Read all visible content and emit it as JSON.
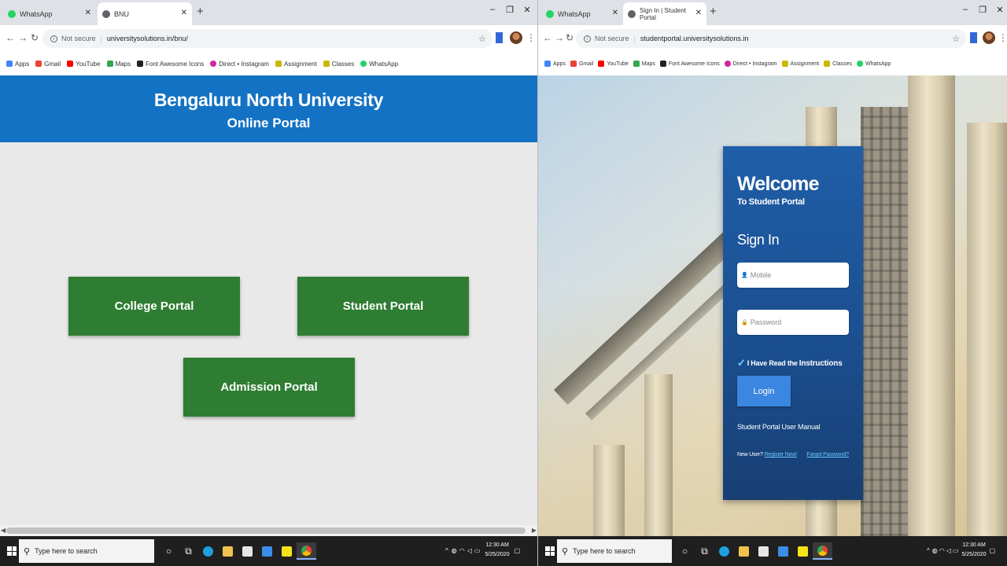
{
  "left": {
    "tabs": [
      {
        "label": "WhatsApp",
        "favicon": "whatsapp-icon"
      },
      {
        "label": "BNU",
        "favicon": "globe-icon",
        "active": true
      }
    ],
    "address": {
      "security": "Not secure",
      "url": "universitysolutions.in/bnu/"
    },
    "bookmarks": [
      "Apps",
      "Gmail",
      "YouTube",
      "Maps",
      "Font Awesome Icons",
      "Direct • Instagram",
      "Assignment",
      "Classes",
      "WhatsApp"
    ],
    "header": {
      "title": "Bengaluru North University",
      "subtitle": "Online Portal"
    },
    "portals": {
      "college": "College Portal",
      "student": "Student Portal",
      "admission": "Admission Portal"
    },
    "colors": {
      "header": "#1372c4",
      "body": "#e9e9e9",
      "button": "#2e7d32"
    }
  },
  "right": {
    "tabs": [
      {
        "label": "WhatsApp",
        "favicon": "whatsapp-icon"
      },
      {
        "label": "Sign In | Student Portal",
        "favicon": "globe-icon",
        "active": true
      }
    ],
    "address": {
      "security": "Not secure",
      "url": "studentportal.universitysolutions.in"
    },
    "bookmarks": [
      "Apps",
      "Gmail",
      "YouTube",
      "Maps",
      "Font Awesome Icons",
      "Direct • Instagram",
      "Assignment",
      "Classes",
      "WhatsApp"
    ],
    "card": {
      "welcome": "Welcome",
      "welcome_sub": "To Student Portal",
      "signin": "Sign In",
      "mobile_placeholder": "Mobile",
      "password_placeholder": "Password",
      "agree_text": "I Have Read the",
      "agree_link": "Instructions",
      "login": "Login",
      "manual": "Student Portal User Manual",
      "new_user": "New User?",
      "register": "Register Now!",
      "forgot": "Forgot Password?"
    },
    "colors": {
      "card": "#1f5ea8",
      "button": "#3a86e0",
      "link": "#6cc5ff"
    }
  },
  "taskbar": {
    "search_placeholder": "Type here to search",
    "time": "12:30 AM",
    "date": "5/25/2020"
  }
}
